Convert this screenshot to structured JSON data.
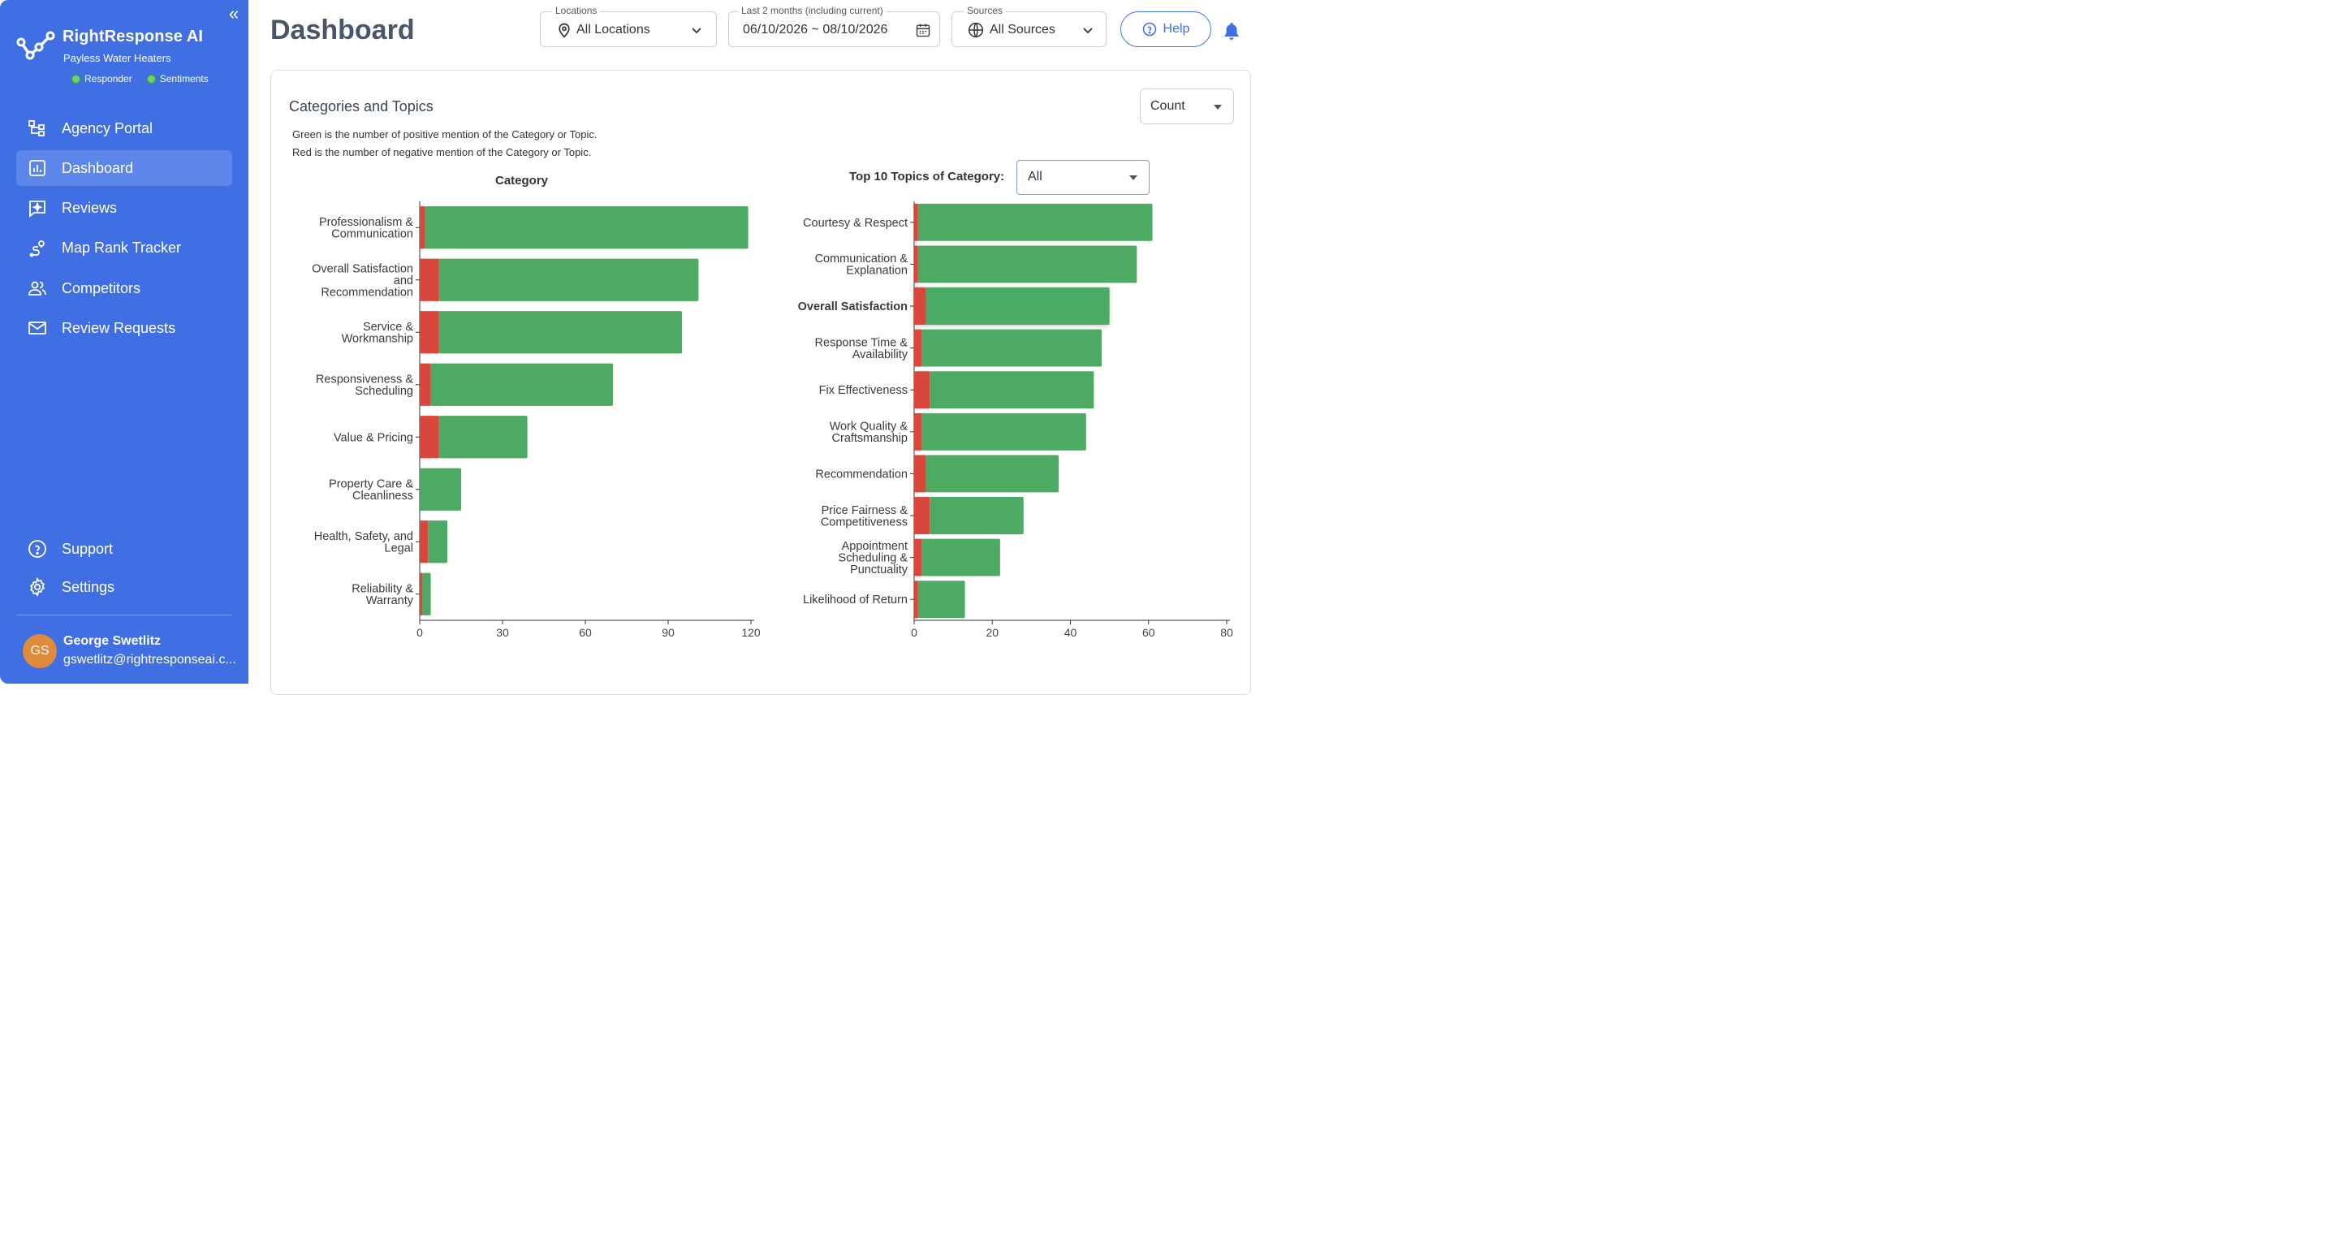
{
  "sidebar": {
    "collapse_label": "«",
    "brand_name": "RightResponse AI",
    "brand_sub": "Payless Water Heaters",
    "status": [
      {
        "label": "Responder"
      },
      {
        "label": "Sentiments"
      }
    ],
    "nav": [
      {
        "label": "Agency Portal",
        "icon": "org-chart-icon",
        "active": false
      },
      {
        "label": "Dashboard",
        "icon": "bar-chart-icon",
        "active": true
      },
      {
        "label": "Reviews",
        "icon": "review-sparkle-icon",
        "active": false
      },
      {
        "label": "Map Rank Tracker",
        "icon": "map-route-icon",
        "active": false
      },
      {
        "label": "Competitors",
        "icon": "users-icon",
        "active": false
      },
      {
        "label": "Review Requests",
        "icon": "mail-icon",
        "active": false
      }
    ],
    "bottom_nav": [
      {
        "label": "Support",
        "icon": "question-circle-icon"
      },
      {
        "label": "Settings",
        "icon": "gear-icon"
      }
    ],
    "user": {
      "initials": "GS",
      "name": "George Swetlitz",
      "email": "gswetlitz@rightresponseai.c..."
    }
  },
  "header": {
    "title": "Dashboard",
    "locations": {
      "label": "Locations",
      "value": "All Locations"
    },
    "date_range": {
      "label": "Last 2 months (including current)",
      "value": "06/10/2026 ~ 08/10/2026"
    },
    "sources": {
      "label": "Sources",
      "value": "All Sources"
    },
    "help_label": "Help"
  },
  "card": {
    "title": "Categories and Topics",
    "desc_line1": "Green is the number of positive mention of the Category or Topic.",
    "desc_line2": "Red is the number of negative mention of the Category or Topic.",
    "metric_select": "Count",
    "topic_filter_label": "Top 10 Topics of Category:",
    "topic_filter_value": "All"
  },
  "colors": {
    "positive": "#4caa63",
    "negative": "#d9473a",
    "accent": "#3f6fe3"
  },
  "chart_data": [
    {
      "type": "bar",
      "orientation": "horizontal",
      "stacked": true,
      "title": "Category",
      "categories": [
        [
          "Professionalism &",
          "Communication"
        ],
        [
          "Overall Satisfaction",
          "and",
          "Recommendation"
        ],
        [
          "Service &",
          "Workmanship"
        ],
        [
          "Responsiveness &",
          "Scheduling"
        ],
        [
          "Value & Pricing"
        ],
        [
          "Property Care &",
          "Cleanliness"
        ],
        [
          "Health, Safety, and",
          "Legal"
        ],
        [
          "Reliability &",
          "Warranty"
        ]
      ],
      "series": [
        {
          "color": "negative",
          "values": [
            2,
            7,
            7,
            4,
            7,
            0,
            3,
            1
          ]
        },
        {
          "color": "positive",
          "values": [
            117,
            94,
            88,
            66,
            32,
            15,
            7,
            3
          ]
        }
      ],
      "xlim": [
        0,
        120
      ],
      "xticks": [
        0,
        30,
        60,
        90,
        120
      ]
    },
    {
      "type": "bar",
      "orientation": "horizontal",
      "stacked": true,
      "title": "Top 10 Topics of Category",
      "categories": [
        [
          "Courtesy & Respect"
        ],
        [
          "Communication &",
          "Explanation"
        ],
        [
          "Overall Satisfaction"
        ],
        [
          "Response Time &",
          "Availability"
        ],
        [
          "Fix Effectiveness"
        ],
        [
          "Work Quality &",
          "Craftsmanship"
        ],
        [
          "Recommendation"
        ],
        [
          "Price Fairness &",
          "Competitiveness"
        ],
        [
          "Appointment",
          "Scheduling &",
          "Punctuality"
        ],
        [
          "Likelihood of Return"
        ]
      ],
      "highlighted_index": 2,
      "series": [
        {
          "color": "negative",
          "values": [
            1,
            1,
            3,
            2,
            4,
            2,
            3,
            4,
            2,
            1
          ]
        },
        {
          "color": "positive",
          "values": [
            60,
            56,
            47,
            46,
            42,
            42,
            34,
            24,
            20,
            12
          ]
        }
      ],
      "xlim": [
        0,
        80
      ],
      "xticks": [
        0,
        20,
        40,
        60,
        80
      ]
    }
  ]
}
